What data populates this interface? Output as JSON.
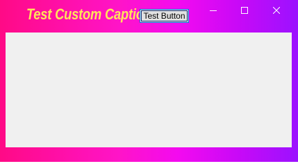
{
  "window": {
    "caption": "Test Custom Caption",
    "button_label": "Test Button",
    "controls": {
      "minimize": "minimize-icon",
      "maximize": "maximize-icon",
      "close": "close-icon"
    }
  },
  "colors": {
    "gradient_left": "#ff0a86",
    "gradient_right": "#9b12ff",
    "caption_text": "#ffe35a",
    "client_background": "#f0f0f0"
  }
}
